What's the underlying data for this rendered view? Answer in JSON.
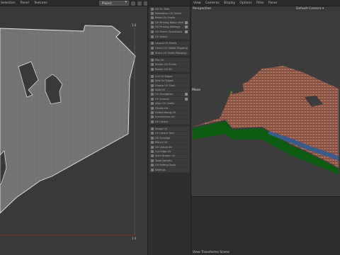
{
  "uv_editor": {
    "menu": [
      "Selection",
      "Panel",
      "Textures"
    ],
    "dropdown_value": "Project",
    "tick_top_right": "1.0",
    "tick_bottom_right": "1.0"
  },
  "property_panel": {
    "sections": [
      {
        "rows": [
          {
            "label": "UV Pin Dist.",
            "check": false
          },
          {
            "label": "Relaxation UV Shells",
            "check": false
          },
          {
            "label": "Relax UV Shells",
            "check": false
          },
          {
            "label": "UV Pinning Relax Shells",
            "check": true
          },
          {
            "label": "UV Pinning Settings",
            "check": true
          },
          {
            "label": "UV Select Operations",
            "check": true
          },
          {
            "label": "UV Select",
            "check": false
          }
        ]
      },
      {
        "rows": [
          {
            "label": "Layout UV Shells",
            "check": false
          },
          {
            "label": "Orient UV Shells Mapping",
            "check": false
          },
          {
            "label": "Stack UV Shells Mapping",
            "check": false
          }
        ]
      },
      {
        "rows": [
          {
            "label": "Flip UV",
            "check": false
          },
          {
            "label": "Rotate UV Shells",
            "check": false
          },
          {
            "label": "Rotate UV 90",
            "check": false
          }
        ]
      },
      {
        "rows": [
          {
            "label": "Cut UV Edges",
            "check": false
          },
          {
            "label": "Sew UV Edges",
            "check": false
          },
          {
            "label": "Create UV Shell",
            "check": false
          },
          {
            "label": "Split UV",
            "check": false
          },
          {
            "label": "UV Straighten",
            "check": true
          },
          {
            "label": "UV Smooth",
            "check": true
          },
          {
            "label": "Align UV Shells",
            "check": false
          },
          {
            "label": "Gridify UV",
            "check": false
          },
          {
            "label": "Unfold Along UV",
            "check": false
          },
          {
            "label": "Symmetrize UV",
            "check": false
          },
          {
            "label": "UV Lattice",
            "check": false
          }
        ]
      },
      {
        "rows": [
          {
            "label": "Image UV",
            "check": false
          },
          {
            "label": "UV Lattice Tool",
            "check": false
          },
          {
            "label": "UV Smudge",
            "check": false
          },
          {
            "label": "Match UV",
            "check": false
          },
          {
            "label": "UV Unfold 3D",
            "check": false
          },
          {
            "label": "Cut Edge UV",
            "check": false
          },
          {
            "label": "Shell Border UV",
            "check": false
          },
          {
            "label": "Texel Density",
            "check": false
          },
          {
            "label": "UV Editing Tools",
            "check": false
          },
          {
            "label": "Settings",
            "check": false
          }
        ]
      }
    ]
  },
  "viewport": {
    "menu": [
      "View",
      "Cameras",
      "Display",
      "Options",
      "Filter",
      "Panel"
    ],
    "view_label": "Perspective",
    "camera_label": "Default Camera",
    "tool_label": "Move",
    "status_label": "View Transforms Scene"
  },
  "colors": {
    "uv_fill": "#6f6f6f",
    "uv_border": "#e6e6e6",
    "terrain_top": "#8a4a3c",
    "terrain_side": "#0d5c12",
    "water": "#3a5a8a",
    "baseline_red": "#8a2a2a"
  }
}
